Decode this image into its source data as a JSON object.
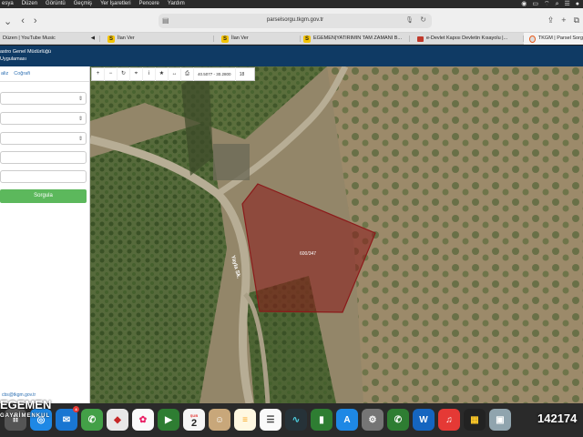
{
  "menubar": {
    "items": [
      "esya",
      "Düzen",
      "Görüntü",
      "Geçmiş",
      "Yer İşaretleri",
      "Pencere",
      "Yardım"
    ]
  },
  "browser": {
    "url": "parselsorgu.tkgm.gov.tr",
    "tabs": [
      {
        "label": "Düzen | YouTube Music"
      },
      {
        "label": "İlan Ver"
      },
      {
        "label": "İlan Ver"
      },
      {
        "label": "EGEMEN|YATIRIMIN TAM ZAMANI B..."
      },
      {
        "label": "e-Devlet Kapısı Devletin Kısayolu |..."
      },
      {
        "label": "TKGM | Parsel Sorg"
      }
    ]
  },
  "app": {
    "header_line1": "astro Genel Müdürlüğü",
    "header_line2": "Uygulaması"
  },
  "sidebar": {
    "tabs": [
      "aliz",
      "Coğrafi"
    ],
    "query_button": "Sorgula",
    "email": "cbs@tkgm.gov.tr"
  },
  "map": {
    "coords": "40.5077 - 30.2800",
    "zoom": "18",
    "parcel_label": "600/347",
    "road_label": "Yayla Sk.",
    "parcel_color": "#8b1a1a"
  },
  "watermark": {
    "line1": "EGEMEN",
    "line2": "GAYRİMENKUL"
  },
  "phone": "142174",
  "dock": {
    "calendar_month": "ŞUB",
    "calendar_day": "2",
    "mail_badge": "4"
  }
}
